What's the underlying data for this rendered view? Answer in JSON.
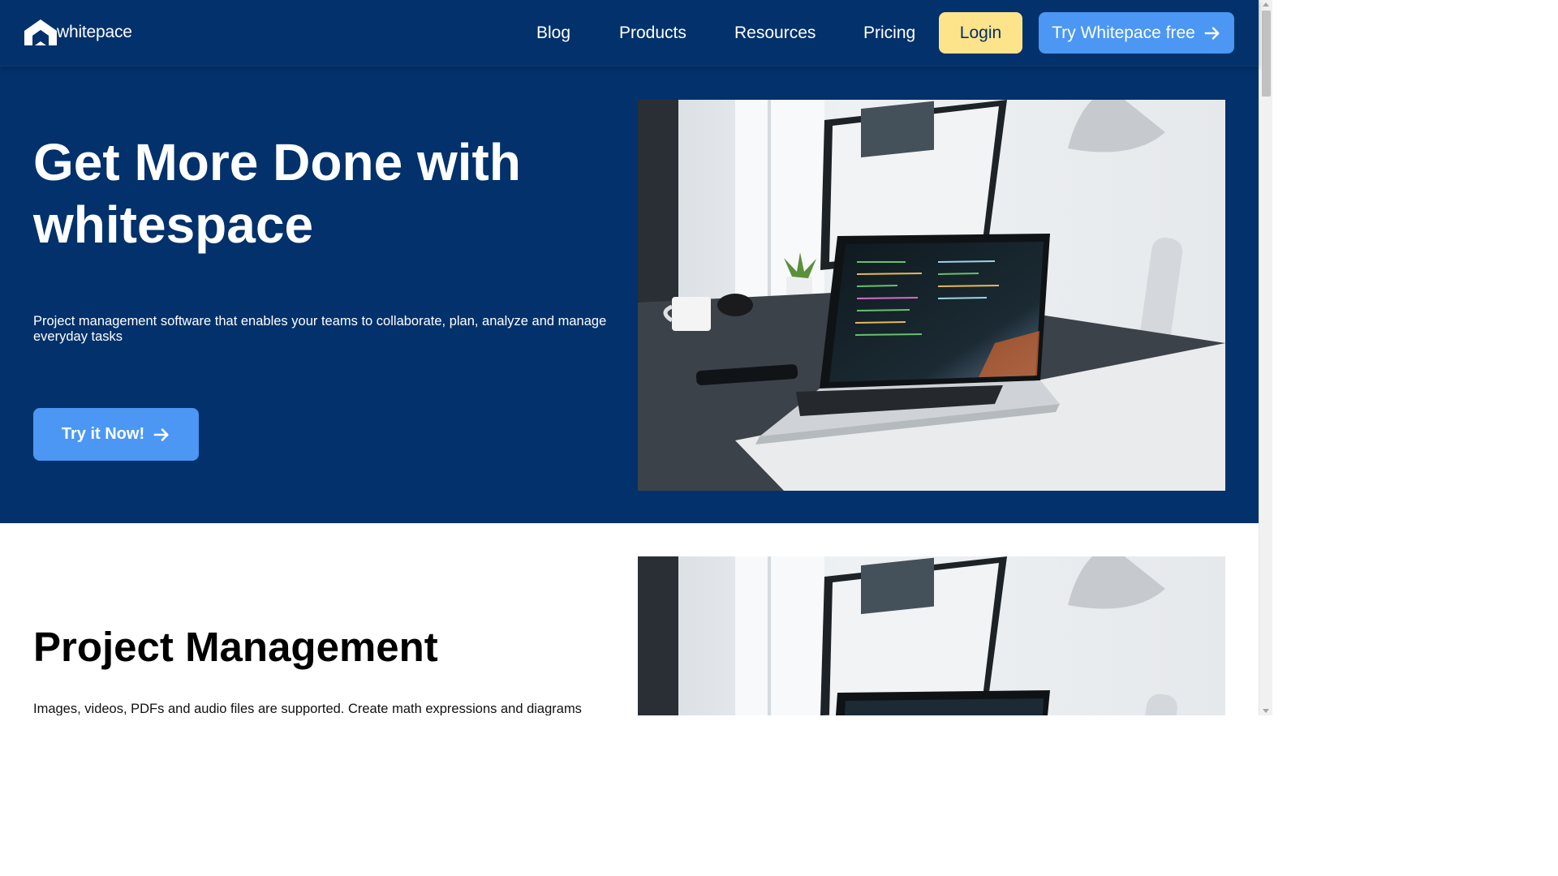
{
  "header": {
    "logo_text": "whitepace",
    "nav": {
      "blog": "Blog",
      "products": "Products",
      "resources": "Resources",
      "pricing": "Pricing"
    },
    "login_label": "Login",
    "try_label": "Try Whitepace free"
  },
  "hero": {
    "title_line1": "Get More Done with",
    "title_line2": "whitespace",
    "subtitle": "Project management software that enables your teams to collaborate, plan, analyze and manage everyday tasks",
    "cta_label": "Try it Now!"
  },
  "section": {
    "title": "Project Management",
    "text": "Images, videos, PDFs and audio files are supported. Create math expressions and diagrams"
  },
  "colors": {
    "brand_navy": "#02316b",
    "accent_blue": "#4b97f3",
    "login_yellow": "#fde38a"
  },
  "icons": [
    "whitepace-logo-icon",
    "arrow-right-icon",
    "desk-photo"
  ]
}
